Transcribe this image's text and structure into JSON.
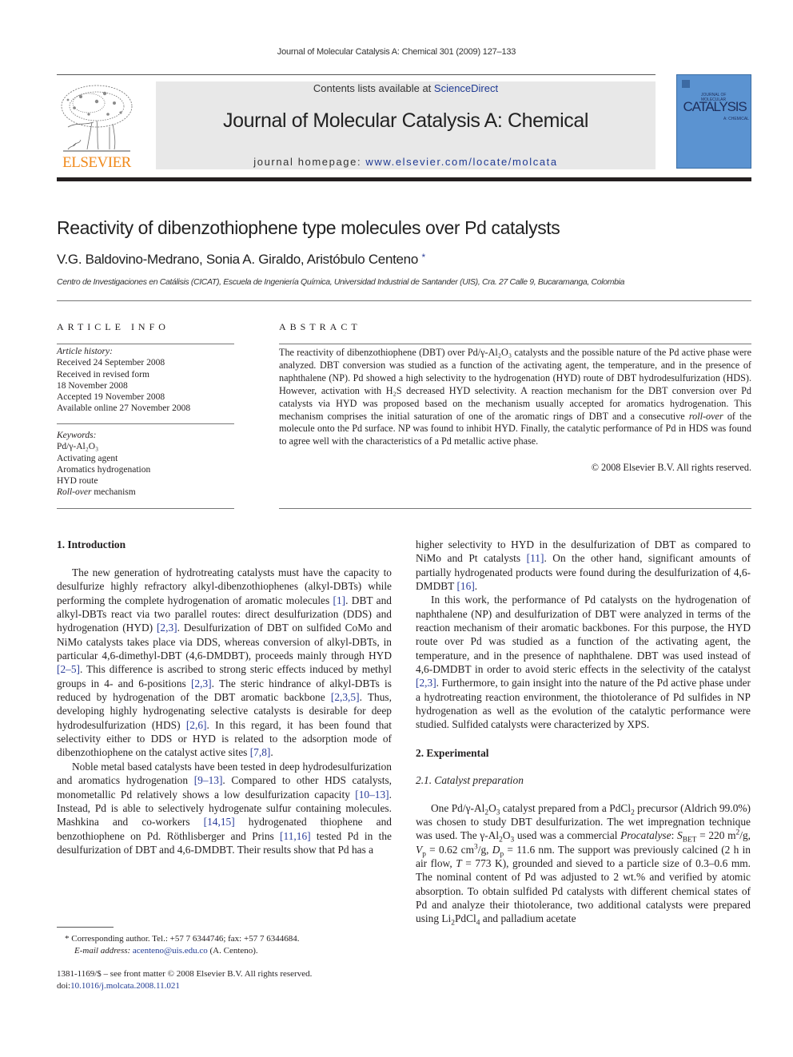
{
  "header": {
    "running_head": "Journal of Molecular Catalysis A: Chemical 301 (2009) 127–133",
    "contents_prefix": "Contents lists available at ",
    "contents_link": "ScienceDirect",
    "journal_title": "Journal of Molecular Catalysis A: Chemical",
    "homepage_prefix": "journal homepage: ",
    "homepage_link": "www.elsevier.com/locate/molcata",
    "publisher_logo_text": "ELSEVIER",
    "cover": {
      "small_text": "JOURNAL OF MOLECULAR",
      "title": "CATALYSIS",
      "subtitle": "A: CHEMICAL"
    }
  },
  "article": {
    "title": "Reactivity of dibenzothiophene type molecules over Pd catalysts",
    "authors": "V.G. Baldovino-Medrano, Sonia A. Giraldo, Aristóbulo Centeno",
    "corresponding_mark": "*",
    "affiliation": "Centro de Investigaciones en Catálisis (CICAT), Escuela de Ingeniería Química, Universidad Industrial de Santander (UIS), Cra. 27 Calle 9, Bucaramanga, Colombia"
  },
  "article_info": {
    "heading": "ARTICLE INFO",
    "history_label": "Article history:",
    "history": [
      "Received 24 September 2008",
      "Received in revised form",
      "18 November 2008",
      "Accepted 19 November 2008",
      "Available online 27 November 2008"
    ],
    "keywords_label": "Keywords:",
    "keywords": [
      "Pd/γ-Al₂O₃",
      "Activating agent",
      "Aromatics hydrogenation",
      "HYD route"
    ],
    "keyword_last_italic": "Roll-over",
    "keyword_last_rest": " mechanism"
  },
  "abstract": {
    "heading": "ABSTRACT",
    "text_1": "The reactivity of dibenzothiophene (DBT) over Pd/γ-Al₂O₃ catalysts and the possible nature of the Pd active phase were analyzed. DBT conversion was studied as a function of the activating agent, the temperature, and in the presence of naphthalene (NP). Pd showed a high selectivity to the hydrogenation (HYD) route of DBT hydrodesulfurization (HDS). However, activation with H₂S decreased HYD selectivity. A reaction mechanism for the DBT conversion over Pd catalysts via HYD was proposed based on the mechanism usually accepted for aromatics hydrogenation. This mechanism comprises the initial saturation of one of the aromatic rings of DBT and a consecutive ",
    "text_italic": "roll-over",
    "text_2": " of the molecule onto the Pd surface. NP was found to inhibit HYD. Finally, the catalytic performance of Pd in HDS was found to agree well with the characteristics of a Pd metallic active phase.",
    "copyright": "© 2008 Elsevier B.V. All rights reserved."
  },
  "introduction": {
    "heading": "1.  Introduction",
    "p1": [
      {
        "t": "The new generation of hydrotreating catalysts must have the capacity to desulfurize highly refractory alkyl-dibenzothiophenes (alkyl-DBTs) while performing the complete hydrogenation of aromatic molecules "
      },
      {
        "c": "[1]"
      },
      {
        "t": ". DBT and alkyl-DBTs react via two parallel routes: direct desulfurization (DDS) and hydrogenation (HYD) "
      },
      {
        "c": "[2,3]"
      },
      {
        "t": ". Desulfurization of DBT on sulfided CoMo and NiMo catalysts takes place via DDS, whereas conversion of alkyl-DBTs, in particular 4,6-dimethyl-DBT (4,6-DMDBT), proceeds mainly through HYD "
      },
      {
        "c": "[2–5]"
      },
      {
        "t": ". This difference is ascribed to strong steric effects induced by methyl groups in 4- and 6-positions "
      },
      {
        "c": "[2,3]"
      },
      {
        "t": ". The steric hindrance of alkyl-DBTs is reduced by hydrogenation of the DBT aromatic backbone "
      },
      {
        "c": "[2,3,5]"
      },
      {
        "t": ". Thus, developing highly hydrogenating selective catalysts is desirable for deep hydrodesulfurization (HDS) "
      },
      {
        "c": "[2,6]"
      },
      {
        "t": ". In this regard, it has been found that selectivity either to DDS or HYD is related to the adsorption mode of dibenzothiophene on the catalyst active sites "
      },
      {
        "c": "[7,8]"
      },
      {
        "t": "."
      }
    ],
    "p2": [
      {
        "t": "Noble metal based catalysts have been tested in deep hydrodesulfurization and aromatics hydrogenation "
      },
      {
        "c": "[9–13]"
      },
      {
        "t": ". Compared to other HDS catalysts, monometallic Pd relatively shows a low desulfurization capacity "
      },
      {
        "c": "[10–13]"
      },
      {
        "t": ". Instead, Pd is able to selectively hydrogenate sulfur containing molecules. Mashkina and co-workers "
      },
      {
        "c": "[14,15]"
      },
      {
        "t": " hydrogenated thiophene and benzothiophene on Pd. Röthlisberger and Prins "
      },
      {
        "c": "[11,16]"
      },
      {
        "t": " tested Pd in the desulfurization of DBT and 4,6-DMDBT. Their results show that Pd has a higher selectivity to HYD in the desulfurization of DBT as compared to NiMo and Pt catalysts "
      },
      {
        "c": "[11]"
      },
      {
        "t": ". On the other hand, significant amounts of partially hydrogenated products were found during the desulfurization of 4,6-DMDBT "
      },
      {
        "c": "[16]"
      },
      {
        "t": "."
      }
    ],
    "p3": [
      {
        "t": "In this work, the performance of Pd catalysts on the hydrogenation of naphthalene (NP) and desulfurization of DBT were analyzed in terms of the reaction mechanism of their aromatic backbones. For this purpose, the HYD route over Pd was studied as a function of the activating agent, the temperature, and in the presence of naphthalene. DBT was used instead of 4,6-DMDBT in order to avoid steric effects in the selectivity of the catalyst "
      },
      {
        "c": "[2,3]"
      },
      {
        "t": ". Furthermore, to gain insight into the nature of the Pd active phase under a hydrotreating reaction environment, the thiotolerance of Pd sulfides in NP hydrogenation as well as the evolution of the catalytic performance were studied. Sulfided catalysts were characterized by XPS."
      }
    ]
  },
  "experimental": {
    "heading": "2.  Experimental",
    "subheading": "2.1.  Catalyst preparation",
    "p1_html": "One Pd/γ-Al<sub>2</sub>O<sub>3</sub> catalyst prepared from a PdCl<sub>2</sub> precursor (Aldrich 99.0%) was chosen to study DBT desulfurization. The wet impregnation technique was used. The γ-Al<sub>2</sub>O<sub>3</sub> used was a commercial <i>Procatalyse</i>: <i>S</i><sub>BET</sub> = 220 m<sup>2</sup>/g, <i>V</i><sub>p</sub> = 0.62 cm<sup>3</sup>/g, <i>D</i><sub>p</sub> = 11.6 nm. The support was previously calcined (2 h in air flow, <i>T</i> = 773 K), grounded and sieved to a particle size of 0.3–0.6 mm. The nominal content of Pd was adjusted to 2 wt.% and verified by atomic absorption. To obtain sulfided Pd catalysts with different chemical states of Pd and analyze their thiotolerance, two additional catalysts were prepared using Li<sub>2</sub>PdCl<sub>4</sub> and palladium acetate"
  },
  "footnotes": {
    "corresponding": "*  Corresponding author. Tel.: +57 7 6344746; fax: +57 7 6344684.",
    "email_label": "E-mail address: ",
    "email": "acenteno@uis.edu.co",
    "email_suffix": " (A. Centeno).",
    "front_matter": "1381-1169/$ – see front matter © 2008 Elsevier B.V. All rights reserved.",
    "doi_label": "doi:",
    "doi": "10.1016/j.molcata.2008.11.021"
  }
}
